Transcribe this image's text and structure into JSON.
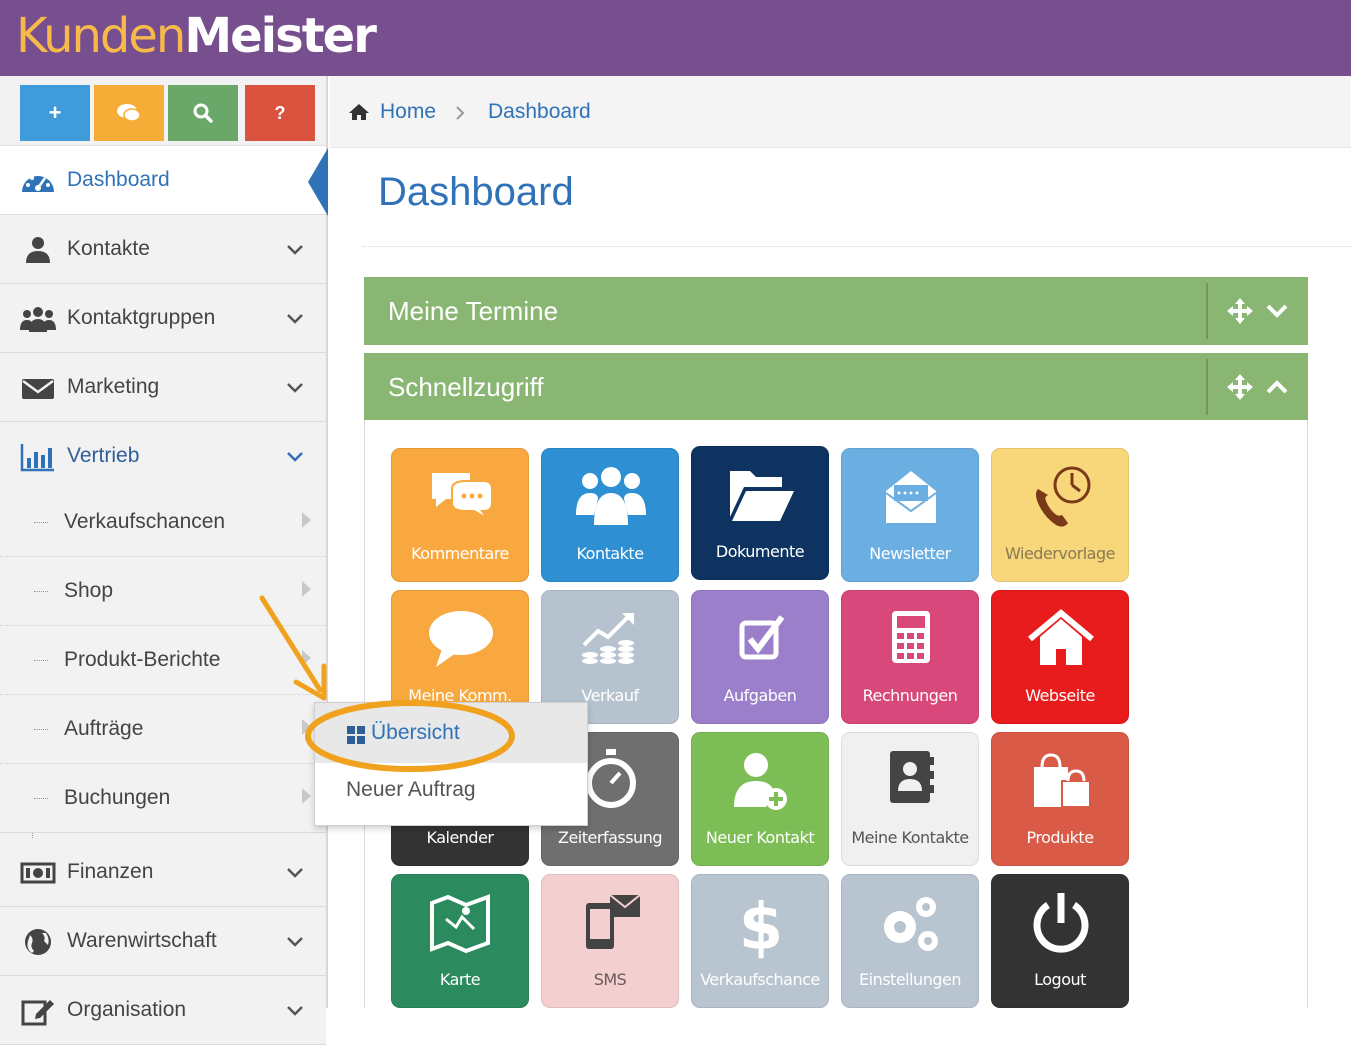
{
  "app": {
    "logo_part1": "Kunden",
    "logo_part2": "Meister"
  },
  "colors": {
    "header": "#774f8e",
    "accent": "#2f72b8",
    "panel_green": "#8ab674",
    "highlight": "#f0a21e"
  },
  "quick_buttons": [
    {
      "label": "+",
      "icon": "plus-icon",
      "color": "#3f9bd9"
    },
    {
      "label": "",
      "icon": "comments-icon",
      "color": "#f6ad38"
    },
    {
      "label": "",
      "icon": "search-icon",
      "color": "#6aa86a"
    },
    {
      "label": "?",
      "icon": "question-icon",
      "color": "#d9533f"
    }
  ],
  "sidebar": {
    "items": [
      {
        "label": "Dashboard",
        "icon": "dashboard-icon"
      },
      {
        "label": "Kontakte",
        "icon": "user-icon"
      },
      {
        "label": "Kontaktgruppen",
        "icon": "users-icon"
      },
      {
        "label": "Marketing",
        "icon": "envelope-icon"
      },
      {
        "label": "Vertrieb",
        "icon": "bar-chart-icon"
      },
      {
        "label": "Finanzen",
        "icon": "money-icon"
      },
      {
        "label": "Warenwirtschaft",
        "icon": "globe-icon"
      },
      {
        "label": "Organisation",
        "icon": "edit-icon"
      }
    ],
    "sub_items": [
      {
        "label": "Verkaufschancen"
      },
      {
        "label": "Shop"
      },
      {
        "label": "Produkt-Berichte"
      },
      {
        "label": "Aufträge"
      },
      {
        "label": "Buchungen"
      }
    ]
  },
  "breadcrumb": {
    "home": "Home",
    "current": "Dashboard"
  },
  "page_title": "Dashboard",
  "panels": {
    "termine": "Meine Termine",
    "schnellzugriff": "Schnellzugriff"
  },
  "tiles": [
    {
      "label": "Kommentare",
      "icon": "comments-icon",
      "color": "#f8a83f"
    },
    {
      "label": "Kontakte",
      "icon": "users-icon",
      "color": "#2e8fd3"
    },
    {
      "label": "Dokumente",
      "icon": "folder-open-icon",
      "color": "#0e3361"
    },
    {
      "label": "Newsletter",
      "icon": "newsletter-icon",
      "color": "#6aaee2"
    },
    {
      "label": "Wiedervorlage",
      "icon": "phone-clock-icon",
      "color": "#f8d77a"
    },
    {
      "label": "Meine Komm.",
      "icon": "speech-bubble-icon",
      "color": "#f8a83f"
    },
    {
      "label": "Verkauf",
      "icon": "sales-growth-icon",
      "color": "#b6c3cf"
    },
    {
      "label": "Aufgaben",
      "icon": "checkbox-icon",
      "color": "#9b7fcb"
    },
    {
      "label": "Rechnungen",
      "icon": "calculator-icon",
      "color": "#d9487a"
    },
    {
      "label": "Webseite",
      "icon": "home-icon",
      "color": "#e81c1c"
    },
    {
      "label": "Kalender",
      "icon": "calendar-icon",
      "color": "#333333"
    },
    {
      "label": "Zeiterfassung",
      "icon": "stopwatch-icon",
      "color": "#6f6f6f"
    },
    {
      "label": "Neuer Kontakt",
      "icon": "add-user-icon",
      "color": "#7cbd55"
    },
    {
      "label": "Meine Kontakte",
      "icon": "address-book-icon",
      "color": "#f0f0f0"
    },
    {
      "label": "Produkte",
      "icon": "shopping-bags-icon",
      "color": "#d85a47"
    },
    {
      "label": "Karte",
      "icon": "map-icon",
      "color": "#2c8a5f"
    },
    {
      "label": "SMS",
      "icon": "mobile-message-icon",
      "color": "#f3cfcf"
    },
    {
      "label": "Verkaufschance",
      "icon": "dollar-icon",
      "color": "#b8c4d0"
    },
    {
      "label": "Einstellungen",
      "icon": "gears-icon",
      "color": "#b8c4d0"
    },
    {
      "label": "Logout",
      "icon": "power-icon",
      "color": "#333333"
    }
  ],
  "popup_menu": {
    "options": [
      "Übersicht",
      "Neuer Auftrag"
    ]
  }
}
